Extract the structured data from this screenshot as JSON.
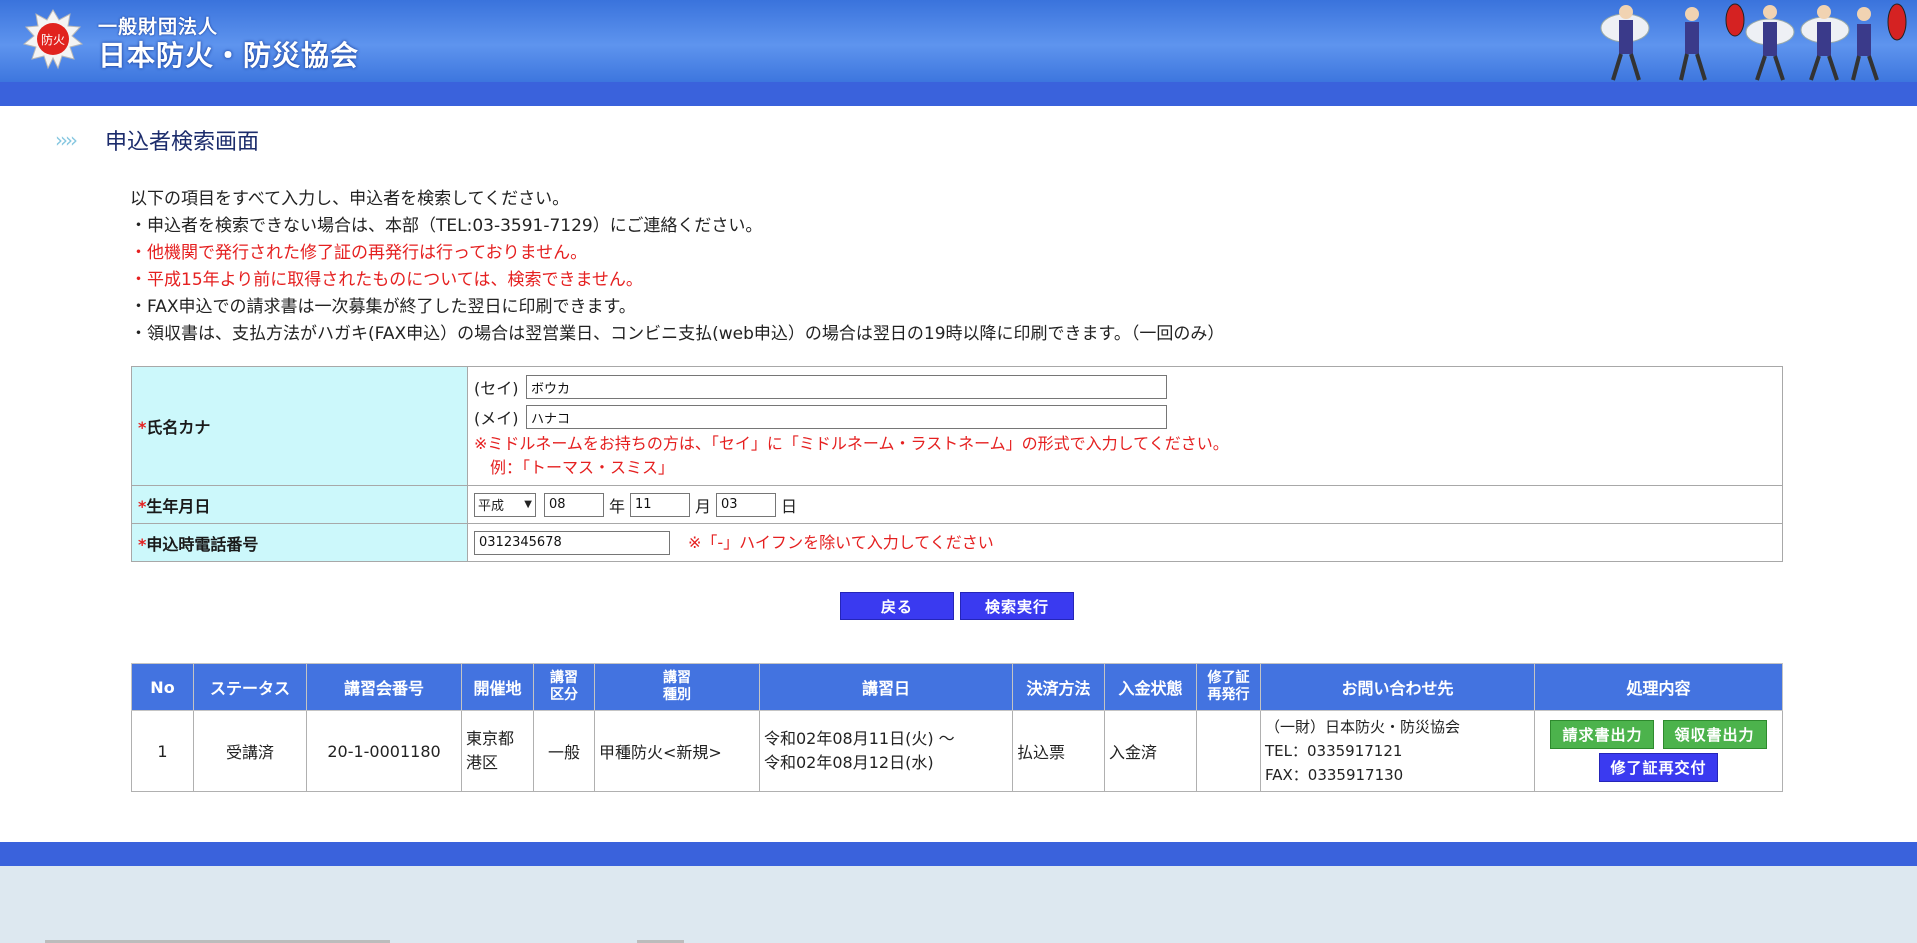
{
  "header": {
    "org_type": "一般財団法人",
    "org_name": "日本防火・防災協会",
    "logo_mark": "防火"
  },
  "page_title": "申込者検索画面",
  "instructions": {
    "line1": "以下の項目をすべて入力し、申込者を検索してください。",
    "line2": "・申込者を検索できない場合は、本部（TEL:03-3591-7129）にご連絡ください。",
    "line3": "・他機関で発行された修了証の再発行は行っておりません。",
    "line4": "・平成15年より前に取得されたものについては、検索できません。",
    "line5": "・FAX申込での請求書は一次募集が終了した翌日に印刷できます。",
    "line6": "・領収書は、支払方法がハガキ(FAX申込）の場合は翌営業日、コンビニ支払(web申込）の場合は翌日の19時以降に印刷できます。（一回のみ）"
  },
  "form": {
    "required_mark": "*",
    "name_label": "氏名カナ",
    "sei_label": "(セイ)",
    "sei_value": "ボウカ",
    "mei_label": "(メイ)",
    "mei_value": "ハナコ",
    "name_note1": "※ミドルネームをお持ちの方は、「セイ」に「ミドルネーム・ラストネーム」の形式で入力してください。",
    "name_note2": "例：「トーマス・スミス」",
    "dob_label": "生年月日",
    "era_value": "平成",
    "year_value": "08",
    "year_unit": "年",
    "month_value": "11",
    "month_unit": "月",
    "day_value": "03",
    "day_unit": "日",
    "phone_label": "申込時電話番号",
    "phone_value": "0312345678",
    "phone_note": "※「-」ハイフンを除いて入力してください"
  },
  "buttons": {
    "back": "戻る",
    "search": "検索実行"
  },
  "results": {
    "headers": {
      "no": "No",
      "status": "ステータス",
      "course_no": "講習会番号",
      "venue": "開催地",
      "category_1": "講習",
      "category_2": "区分",
      "type_1": "講習",
      "type_2": "種別",
      "date": "講習日",
      "payment": "決済方法",
      "deposit": "入金状態",
      "reissue_1": "修了証",
      "reissue_2": "再発行",
      "contact": "お問い合わせ先",
      "action": "処理内容"
    },
    "rows": [
      {
        "no": "1",
        "status": "受講済",
        "course_no": "20-1-0001180",
        "venue_1": "東京都",
        "venue_2": "港区",
        "category": "一般",
        "type": "甲種防火<新規>",
        "date_1": "令和02年08月11日(火) 〜",
        "date_2": "令和02年08月12日(水)",
        "payment": "払込票",
        "deposit": "入金済",
        "reissue": "",
        "contact_1": "（一財）日本防火・防災協会",
        "contact_2": "TEL：0335917121",
        "contact_3": "FAX：0335917130",
        "invoice_button": "請求書出力",
        "receipt_button": "領収書出力",
        "reissue_button": "修了証再交付"
      }
    ]
  },
  "colors": {
    "header_blue": "#3a62dc",
    "label_bg": "#ccf8fb",
    "alert_red": "#e52020",
    "button_blue": "#3a3af0",
    "button_green": "#4cb34c",
    "footer_bg": "#dde8f0"
  }
}
